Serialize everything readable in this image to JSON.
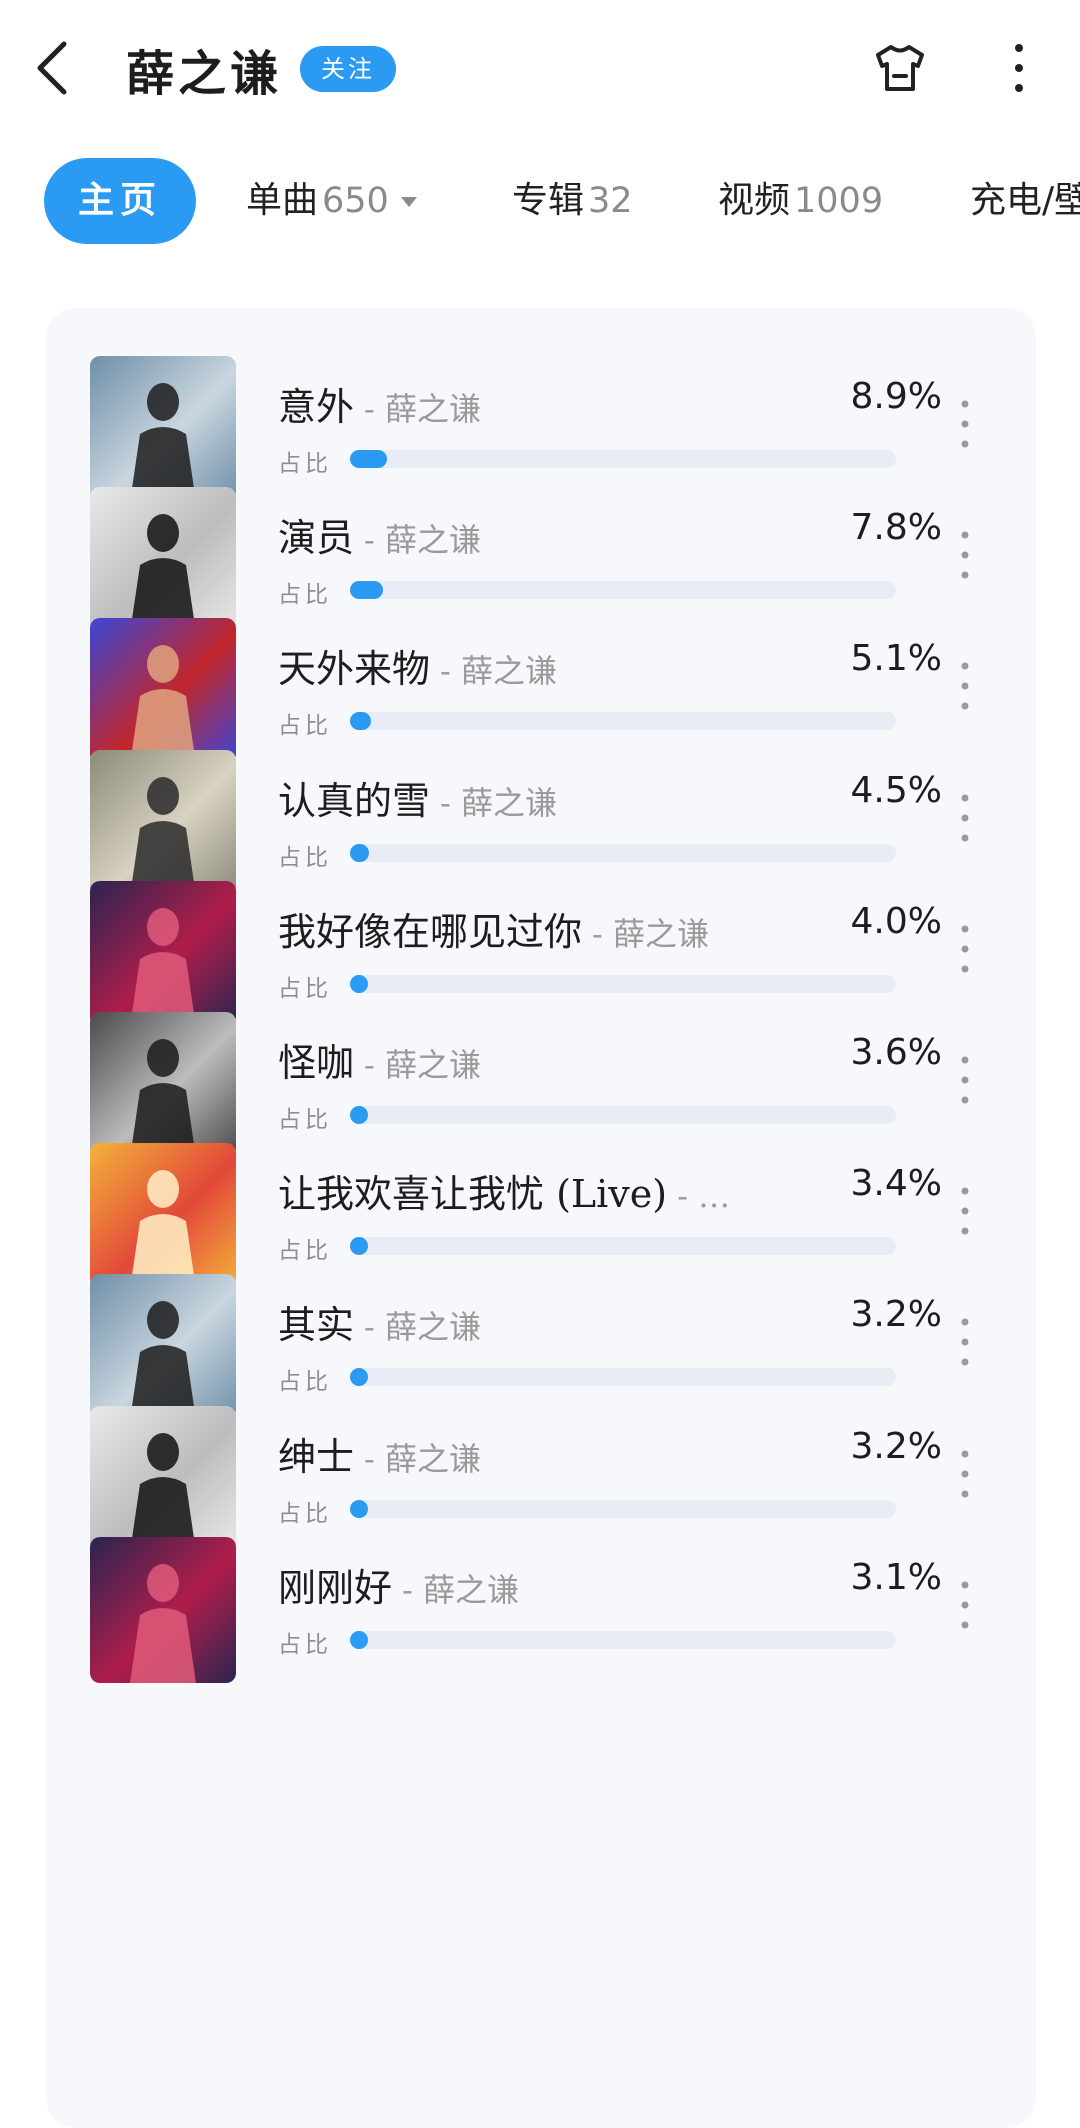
{
  "header": {
    "title": "薛之谦",
    "follow_label": "关注",
    "icons": {
      "back": "chevron-left-icon",
      "outfit": "tshirt-icon",
      "more": "more-vertical-icon"
    }
  },
  "tabs": [
    {
      "label": "主页",
      "count": ""
    },
    {
      "label": "单曲",
      "count": "650"
    },
    {
      "label": "专辑",
      "count": "32"
    },
    {
      "label": "视频",
      "count": "1009"
    },
    {
      "label": "充电/壁",
      "count": ""
    }
  ],
  "ratio_label": "占比",
  "songs": [
    {
      "title": "意外",
      "artist": "- 薛之谦",
      "percent": "8.9%",
      "share": 8.9
    },
    {
      "title": "演员",
      "artist": "- 薛之谦",
      "percent": "7.8%",
      "share": 7.8
    },
    {
      "title": "天外来物",
      "artist": "- 薛之谦",
      "percent": "5.1%",
      "share": 5.1
    },
    {
      "title": "认真的雪",
      "artist": "- 薛之谦",
      "percent": "4.5%",
      "share": 4.5
    },
    {
      "title": "我好像在哪见过你",
      "artist": "- 薛之谦",
      "percent": "4.0%",
      "share": 4.0
    },
    {
      "title": "怪咖",
      "artist": "- 薛之谦",
      "percent": "3.6%",
      "share": 3.6
    },
    {
      "title": "让我欢喜让我忧 (Live)",
      "artist": "- …",
      "percent": "3.4%",
      "share": 3.4
    },
    {
      "title": "其实",
      "artist": "- 薛之谦",
      "percent": "3.2%",
      "share": 3.2
    },
    {
      "title": "绅士",
      "artist": "- 薛之谦",
      "percent": "3.2%",
      "share": 3.2
    },
    {
      "title": "刚刚好",
      "artist": "- 薛之谦",
      "percent": "3.1%",
      "share": 3.1
    }
  ],
  "colors": {
    "accent": "#2b9af3",
    "track": "#e8ecf4",
    "card": "#f6f8fc"
  }
}
